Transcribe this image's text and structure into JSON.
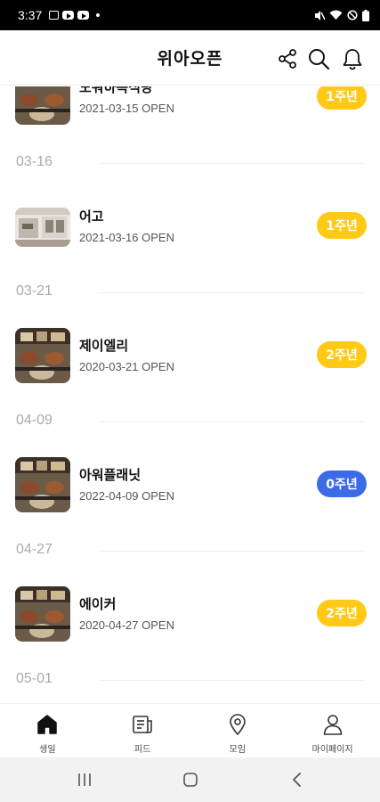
{
  "status_bar": {
    "time": "3:37"
  },
  "header": {
    "title": "위아오픈",
    "share_icon": "share-icon",
    "search_icon": "search-icon",
    "bell_icon": "bell-icon"
  },
  "colors": {
    "badge_yellow": "#FFC915",
    "badge_blue": "#3C6BE8",
    "date_text": "#AAAAAA"
  },
  "list": {
    "stores": [
      {
        "name": "노워하측식당",
        "date": "2021-03-15 OPEN",
        "badge": "1주년",
        "badge_color": "#FFC915"
      },
      {
        "name": "어고",
        "date": "2021-03-16 OPEN",
        "badge": "1주년",
        "badge_color": "#FFC915"
      },
      {
        "name": "제이엘리",
        "date": "2020-03-21 OPEN",
        "badge": "2주년",
        "badge_color": "#FFC915"
      },
      {
        "name": "아워플래닛",
        "date": "2022-04-09 OPEN",
        "badge": "0주년",
        "badge_color": "#3C6BE8"
      },
      {
        "name": "에이커",
        "date": "2020-04-27 OPEN",
        "badge": "2주년",
        "badge_color": "#FFC915"
      }
    ],
    "date_headers": [
      "03-16",
      "03-21",
      "04-09",
      "04-27",
      "05-01"
    ]
  },
  "bottom_nav": [
    {
      "label": "생일",
      "icon": "home-icon",
      "active": true
    },
    {
      "label": "피드",
      "icon": "feed-icon",
      "active": false
    },
    {
      "label": "모임",
      "icon": "location-pin-icon",
      "active": false
    },
    {
      "label": "마이페이지",
      "icon": "person-icon",
      "active": false
    }
  ]
}
